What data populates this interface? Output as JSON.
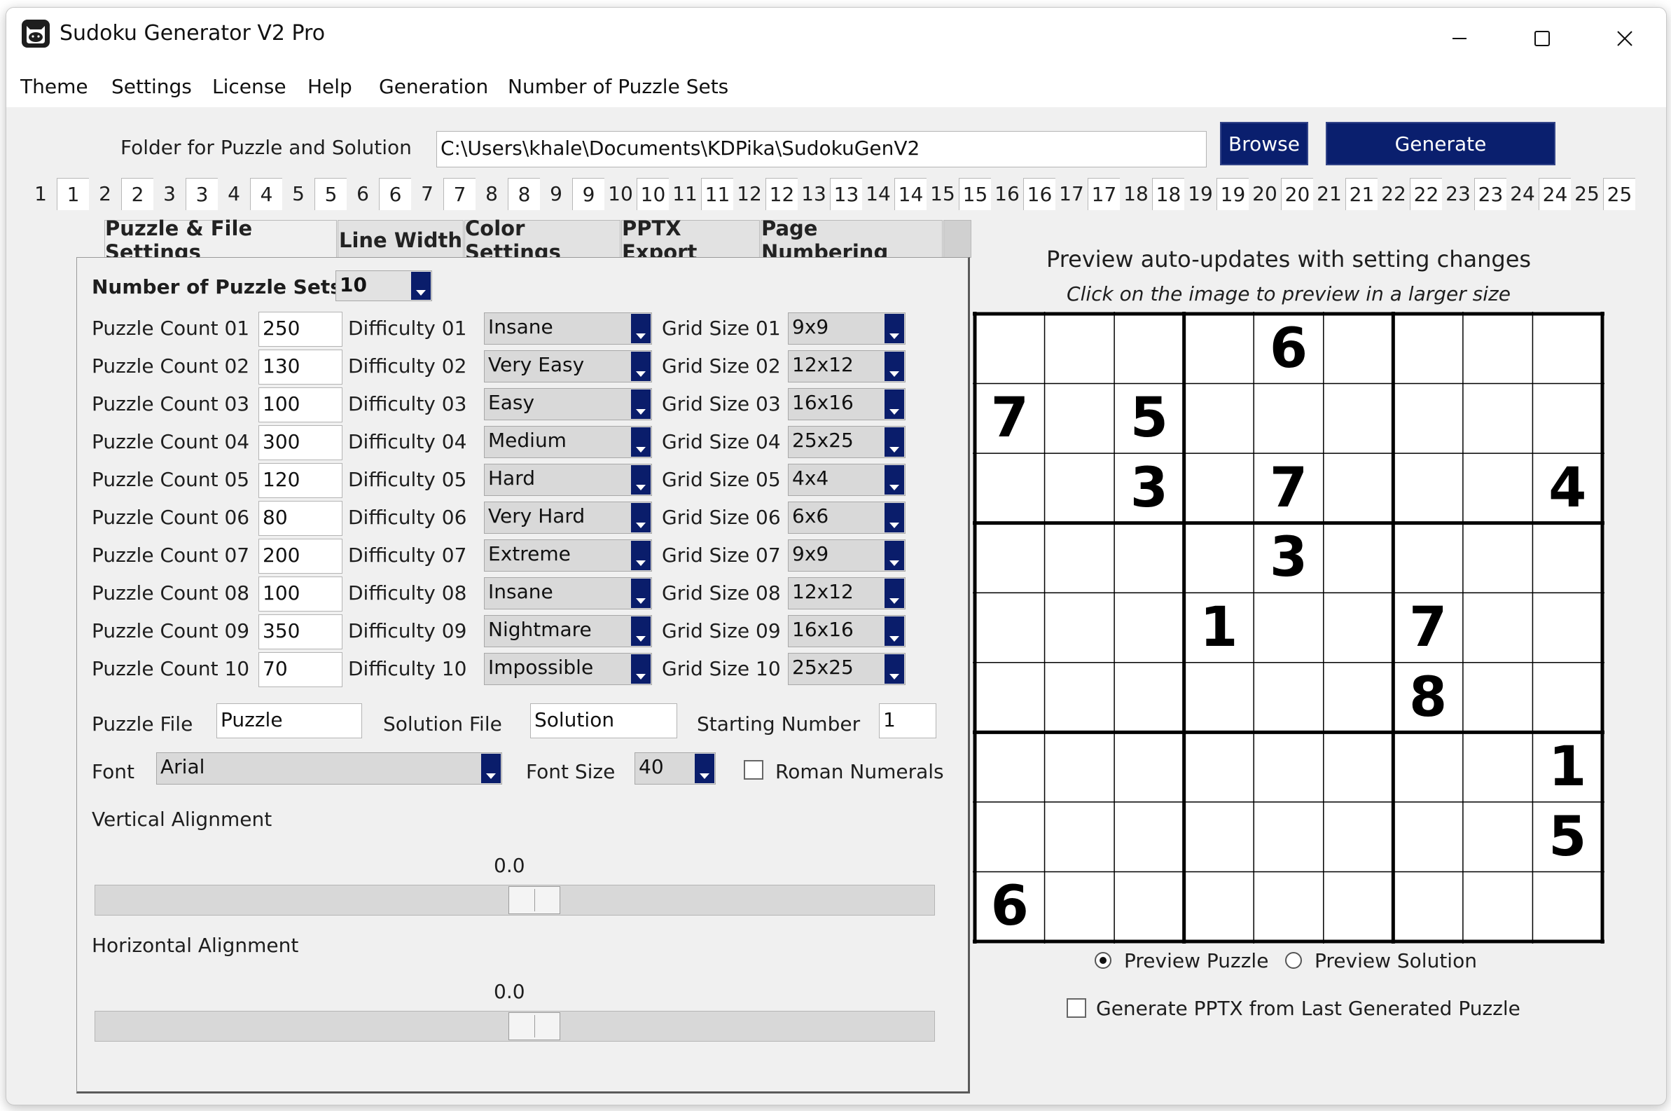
{
  "window": {
    "title": "Sudoku Generator V2 Pro",
    "controls": {
      "minimize": "minimize-icon",
      "maximize": "maximize-icon",
      "close": "close-icon"
    }
  },
  "menu": [
    "Theme",
    "Settings",
    "License",
    "Help",
    "Generation",
    "Number of Puzzle Sets"
  ],
  "folder": {
    "label": "Folder for Puzzle and Solution",
    "path": "C:\\Users\\khale\\Documents\\KDPika\\SudokuGenV2",
    "browse_label": "Browse",
    "generate_label": "Generate"
  },
  "set_tabs": [
    "1",
    "1",
    "2",
    "2",
    "3",
    "3",
    "4",
    "4",
    "5",
    "5",
    "6",
    "6",
    "7",
    "7",
    "8",
    "8",
    "9",
    "9",
    "10",
    "10",
    "11",
    "11",
    "12",
    "12",
    "13",
    "13",
    "14",
    "14",
    "15",
    "15",
    "16",
    "16",
    "17",
    "17",
    "18",
    "18",
    "19",
    "19",
    "20",
    "20",
    "21",
    "21",
    "22",
    "22",
    "23",
    "23",
    "24",
    "24",
    "25",
    "25"
  ],
  "tabs": [
    "Puzzle & File Settings",
    "Line Width",
    "Color Settings",
    "PPTX Export",
    "Page Numbering"
  ],
  "settings": {
    "sets_label": "Number of Puzzle Sets",
    "sets_value": "10",
    "rows": [
      {
        "count_label": "Puzzle Count 01",
        "count": "250",
        "diff_label": "Difficulty 01",
        "difficulty": "Insane",
        "grid_label": "Grid Size 01",
        "grid": "9x9"
      },
      {
        "count_label": "Puzzle Count 02",
        "count": "130",
        "diff_label": "Difficulty 02",
        "difficulty": "Very Easy",
        "grid_label": "Grid Size 02",
        "grid": "12x12"
      },
      {
        "count_label": "Puzzle Count 03",
        "count": "100",
        "diff_label": "Difficulty 03",
        "difficulty": "Easy",
        "grid_label": "Grid Size 03",
        "grid": "16x16"
      },
      {
        "count_label": "Puzzle Count 04",
        "count": "300",
        "diff_label": "Difficulty 04",
        "difficulty": "Medium",
        "grid_label": "Grid Size 04",
        "grid": "25x25"
      },
      {
        "count_label": "Puzzle Count 05",
        "count": "120",
        "diff_label": "Difficulty 05",
        "difficulty": "Hard",
        "grid_label": "Grid Size 05",
        "grid": "4x4"
      },
      {
        "count_label": "Puzzle Count 06",
        "count": "80",
        "diff_label": "Difficulty 06",
        "difficulty": "Very Hard",
        "grid_label": "Grid Size 06",
        "grid": "6x6"
      },
      {
        "count_label": "Puzzle Count 07",
        "count": "200",
        "diff_label": "Difficulty 07",
        "difficulty": "Extreme",
        "grid_label": "Grid Size 07",
        "grid": "9x9"
      },
      {
        "count_label": "Puzzle Count 08",
        "count": "100",
        "diff_label": "Difficulty 08",
        "difficulty": "Insane",
        "grid_label": "Grid Size 08",
        "grid": "12x12"
      },
      {
        "count_label": "Puzzle Count 09",
        "count": "350",
        "diff_label": "Difficulty 09",
        "difficulty": "Nightmare",
        "grid_label": "Grid Size 09",
        "grid": "16x16"
      },
      {
        "count_label": "Puzzle Count 10",
        "count": "70",
        "diff_label": "Difficulty 10",
        "difficulty": "Impossible",
        "grid_label": "Grid Size 10",
        "grid": "25x25"
      }
    ],
    "puzzle_file_label": "Puzzle File",
    "puzzle_file": "Puzzle",
    "solution_file_label": "Solution File",
    "solution_file": "Solution",
    "starting_number_label": "Starting Number",
    "starting_number": "1",
    "font_label": "Font",
    "font": "Arial",
    "font_size_label": "Font Size",
    "font_size": "40",
    "roman_numerals_label": "Roman Numerals",
    "roman_numerals": false,
    "vertical_label": "Vertical Alignment",
    "vertical_value": "0.0",
    "horizontal_label": "Horizontal Alignment",
    "horizontal_value": "0.0",
    "slider_min": -1,
    "slider_max": 1
  },
  "preview": {
    "heading": "Preview auto-updates with setting changes",
    "subheading": "Click on the image to preview in a larger size",
    "grid": [
      [
        "",
        "",
        "",
        "",
        "6",
        "",
        "",
        "",
        ""
      ],
      [
        "7",
        "",
        "5",
        "",
        "",
        "",
        "",
        "",
        ""
      ],
      [
        "",
        "",
        "3",
        "",
        "7",
        "",
        "",
        "",
        "4"
      ],
      [
        "",
        "",
        "",
        "",
        "3",
        "",
        "",
        "",
        ""
      ],
      [
        "",
        "",
        "",
        "1",
        "",
        "",
        "7",
        "",
        ""
      ],
      [
        "",
        "",
        "",
        "",
        "",
        "",
        "8",
        "",
        ""
      ],
      [
        "",
        "",
        "",
        "",
        "",
        "",
        "",
        "",
        "1"
      ],
      [
        "",
        "",
        "",
        "",
        "",
        "",
        "",
        "",
        "5"
      ],
      [
        "6",
        "",
        "",
        "",
        "",
        "",
        "",
        "",
        ""
      ]
    ],
    "preview_puzzle_label": "Preview Puzzle",
    "preview_solution_label": "Preview Solution",
    "selected": "puzzle",
    "pptx_label": "Generate PPTX from Last Generated Puzzle",
    "pptx_checked": false
  },
  "colors": {
    "accent": "#0a1f6e",
    "window_bg": "#f0f0f0"
  }
}
